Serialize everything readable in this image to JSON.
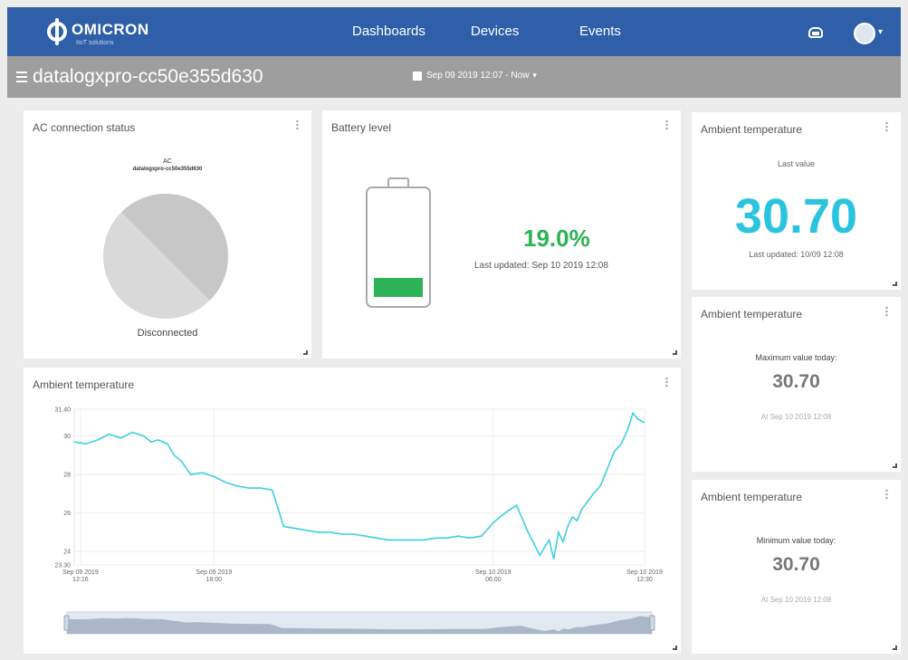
{
  "nav": {
    "logo_text": "OMICRON",
    "logo_sub": "IIoT solutions",
    "links": [
      "Dashboards",
      "Devices",
      "Events"
    ]
  },
  "subheader": {
    "device_name": "datalogxpro-cc50e355d630",
    "date_range": "Sep 09 2019 12:07 - Now"
  },
  "ac_panel": {
    "title": "AC connection status",
    "label": "AC",
    "device": "datalogxpro-cc50e355d630",
    "status": "Disconnected",
    "colors": {
      "slice_a": "#c7c7c7",
      "slice_b": "#d9d9d9"
    }
  },
  "battery_panel": {
    "title": "Battery level",
    "value": "19.0%",
    "level": 0.19,
    "updated": "Last updated: Sep 10 2019 12:08",
    "color": "#2db356"
  },
  "last_value_panel": {
    "title": "Ambient temperature",
    "label": "Last value",
    "value": "30.70",
    "updated": "Last updated: 10/09 12:08",
    "color": "#2bc4de"
  },
  "max_panel": {
    "title": "Ambient temperature",
    "label": "Maximum value today:",
    "value": "30.70",
    "at": "At Sep 10 2019 12:08"
  },
  "min_panel": {
    "title": "Ambient temperature",
    "label": "Minimum value today:",
    "value": "30.70",
    "at": "At Sep 10 2019 12:08"
  },
  "chart_panel": {
    "title": "Ambient temperature"
  },
  "chart_data": {
    "type": "line",
    "title": "Ambient temperature",
    "xlabel": "",
    "ylabel": "",
    "ylim": [
      23.3,
      31.4
    ],
    "y_ticks": [
      "31.40",
      "30",
      "28",
      "26",
      "24",
      "23.30"
    ],
    "y_tick_values": [
      31.4,
      30,
      28,
      26,
      24,
      23.3
    ],
    "x_ticks": [
      "Sep 09 2019 12:16",
      "Sep 09 2019 18:00",
      "Sep 10 2019 06:00",
      "Sep 10 2019 12:30"
    ],
    "x_tick_hours": [
      0.27,
      6.0,
      18.0,
      24.5
    ],
    "x_range_hours": [
      0,
      24.5
    ],
    "grid": true,
    "line_color": "#3ecfe0",
    "series": [
      {
        "x": [
          0,
          0.5,
          1,
          1.5,
          2,
          2.5,
          3,
          3.3,
          3.6,
          4,
          4.3,
          4.6,
          5,
          5.5,
          6,
          6.5,
          7,
          7.5,
          8,
          8.5,
          9,
          9.5,
          10,
          10.5,
          11,
          11.5,
          12,
          12.5,
          13,
          13.5,
          14,
          14.5,
          15,
          15.5,
          16,
          16.5,
          17,
          17.5,
          18,
          18.5,
          19,
          19.5,
          20,
          20.2,
          20.4,
          20.6,
          20.8,
          21,
          21.2,
          21.4,
          21.6,
          21.8,
          22,
          22.3,
          22.6,
          22.9,
          23.2,
          23.5,
          23.8,
          24,
          24.2,
          24.5
        ],
        "y": [
          29.7,
          29.6,
          29.8,
          30.1,
          29.9,
          30.2,
          30.0,
          29.7,
          29.8,
          29.6,
          29.0,
          28.7,
          28.0,
          28.1,
          27.9,
          27.6,
          27.4,
          27.3,
          27.3,
          27.2,
          25.3,
          25.2,
          25.1,
          25.0,
          25.0,
          24.9,
          24.9,
          24.8,
          24.7,
          24.6,
          24.6,
          24.6,
          24.6,
          24.7,
          24.7,
          24.8,
          24.7,
          24.8,
          25.5,
          26.0,
          26.4,
          25.0,
          23.8,
          24.2,
          24.6,
          23.6,
          25.0,
          24.5,
          25.3,
          25.8,
          25.6,
          26.2,
          26.5,
          27.0,
          27.4,
          28.3,
          29.2,
          29.6,
          30.4,
          31.2,
          30.9,
          30.7
        ]
      }
    ]
  }
}
